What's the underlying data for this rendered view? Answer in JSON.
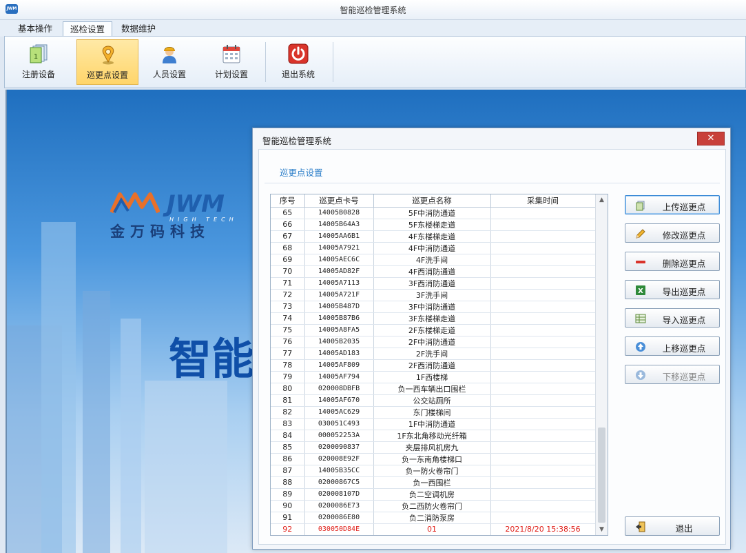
{
  "window": {
    "title": "智能巡检管理系统",
    "icon_text": "JWM"
  },
  "tabs": [
    {
      "label": "基本操作",
      "active": false
    },
    {
      "label": "巡检设置",
      "active": true
    },
    {
      "label": "数据维护",
      "active": false
    }
  ],
  "ribbon": [
    {
      "label": "注册设备",
      "icon": "register-device-icon"
    },
    {
      "label": "巡更点设置",
      "icon": "location-pin-icon",
      "selected": true
    },
    {
      "label": "人员设置",
      "icon": "worker-icon"
    },
    {
      "label": "计划设置",
      "icon": "calendar-icon"
    },
    {
      "label": "退出系统",
      "icon": "power-icon"
    }
  ],
  "background": {
    "logo_text": "JWM",
    "logo_sub": "HIGH TECH",
    "logo_cn": "金万码科技",
    "big_text": "智能"
  },
  "dialog": {
    "title": "智能巡检管理系统",
    "close_label": "✕",
    "section_title": "巡更点设置",
    "columns": [
      "序号",
      "巡更点卡号",
      "巡更点名称",
      "采集时间"
    ],
    "rows": [
      [
        "65",
        "14005B0828",
        "5F中消防通道",
        ""
      ],
      [
        "66",
        "14005B64A3",
        "5F东楼梯走道",
        ""
      ],
      [
        "67",
        "14005AA6B1",
        "4F东楼梯走道",
        ""
      ],
      [
        "68",
        "14005A7921",
        "4F中消防通道",
        ""
      ],
      [
        "69",
        "14005AEC6C",
        "4F洗手间",
        ""
      ],
      [
        "70",
        "14005AD82F",
        "4F西消防通道",
        ""
      ],
      [
        "71",
        "14005A7113",
        "3F西消防通道",
        ""
      ],
      [
        "72",
        "14005A721F",
        "3F洗手间",
        ""
      ],
      [
        "73",
        "14005B487D",
        "3F中消防通道",
        ""
      ],
      [
        "74",
        "14005B87B6",
        "3F东楼梯走道",
        ""
      ],
      [
        "75",
        "14005A8FA5",
        "2F东楼梯走道",
        ""
      ],
      [
        "76",
        "14005B2035",
        "2F中消防通道",
        ""
      ],
      [
        "77",
        "14005AD183",
        "2F洗手间",
        ""
      ],
      [
        "78",
        "14005AF809",
        "2F西消防通道",
        ""
      ],
      [
        "79",
        "14005AF794",
        "1F西楼梯",
        ""
      ],
      [
        "80",
        "020008DBFB",
        "负一西车辆出口围栏",
        ""
      ],
      [
        "81",
        "14005AF670",
        "公交站厕所",
        ""
      ],
      [
        "82",
        "14005AC629",
        "东门楼梯间",
        ""
      ],
      [
        "83",
        "030051C493",
        "1F中消防通道",
        ""
      ],
      [
        "84",
        "000052253A",
        "1F东北角移动光纤箱",
        ""
      ],
      [
        "85",
        "0200090837",
        "夹层排风机房九",
        ""
      ],
      [
        "86",
        "020008E92F",
        "负一东南角楼梯口",
        ""
      ],
      [
        "87",
        "14005B35CC",
        "负一防火卷帘门",
        ""
      ],
      [
        "88",
        "02000867C5",
        "负一西围栏",
        ""
      ],
      [
        "89",
        "020008107D",
        "负二空调机房",
        ""
      ],
      [
        "90",
        "0200086E73",
        "负二西防火卷帘门",
        ""
      ],
      [
        "91",
        "0200086E80",
        "负二消防泵房",
        ""
      ],
      [
        "92",
        "030050D84E",
        "01",
        "2021/8/20 15:38:56"
      ]
    ],
    "highlight_row": 27,
    "buttons": [
      {
        "label": "上传巡更点",
        "icon": "upload-icon"
      },
      {
        "label": "修改巡更点",
        "icon": "pencil-icon"
      },
      {
        "label": "删除巡更点",
        "icon": "minus-icon"
      },
      {
        "label": "导出巡更点",
        "icon": "excel-icon"
      },
      {
        "label": "导入巡更点",
        "icon": "import-icon"
      },
      {
        "label": "上移巡更点",
        "icon": "arrow-up-icon"
      },
      {
        "label": "下移巡更点",
        "icon": "arrow-down-icon",
        "disabled": true
      }
    ],
    "exit_label": "退出"
  },
  "colors": {
    "accent": "#2d7fc9",
    "highlight_row_text": "#e0201a",
    "selected_ribbon": "#ffd56a"
  }
}
